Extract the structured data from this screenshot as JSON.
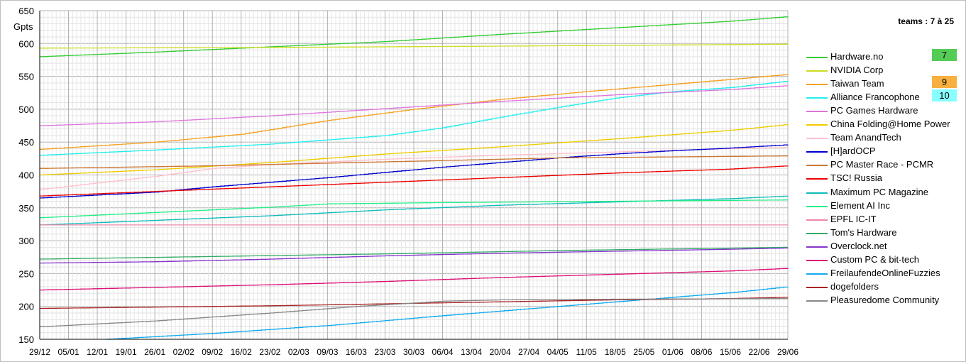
{
  "chart_data": {
    "type": "line",
    "subtitle": "teams : 7 à 25",
    "ylabel": "Gpts",
    "ylim": [
      150,
      650
    ],
    "yticks": [
      150,
      200,
      250,
      300,
      350,
      400,
      450,
      500,
      550,
      600,
      650
    ],
    "grid": true,
    "legend_position": "right",
    "x_labels": [
      "29/12",
      "05/01",
      "12/01",
      "19/01",
      "26/01",
      "02/02",
      "09/02",
      "16/02",
      "23/02",
      "02/03",
      "09/03",
      "16/03",
      "23/03",
      "30/03",
      "06/04",
      "13/04",
      "20/04",
      "27/04",
      "04/05",
      "11/05",
      "18/05",
      "25/05",
      "01/06",
      "08/06",
      "15/06",
      "22/06",
      "29/06"
    ],
    "series": [
      {
        "name": "Hardware.no",
        "color": "#33cc33",
        "anchors": [
          [
            0,
            580
          ],
          [
            4,
            587
          ],
          [
            8,
            595
          ],
          [
            12,
            603
          ],
          [
            16,
            614
          ],
          [
            20,
            624
          ],
          [
            24,
            634
          ],
          [
            26,
            641
          ]
        ]
      },
      {
        "name": "NVIDIA Corp",
        "color": "#ccdd22",
        "anchors": [
          [
            0,
            593
          ],
          [
            8,
            594
          ],
          [
            16,
            596
          ],
          [
            26,
            599
          ]
        ]
      },
      {
        "name": "Taiwan Team",
        "color": "#f5a020",
        "anchors": [
          [
            0,
            439
          ],
          [
            4,
            450
          ],
          [
            7,
            462
          ],
          [
            10,
            483
          ],
          [
            13,
            500
          ],
          [
            16,
            515
          ],
          [
            19,
            527
          ],
          [
            22,
            538
          ],
          [
            26,
            553
          ]
        ]
      },
      {
        "name": "Alliance Francophone",
        "color": "#22eeee",
        "anchors": [
          [
            0,
            430
          ],
          [
            4,
            438
          ],
          [
            8,
            447
          ],
          [
            12,
            460
          ],
          [
            14,
            472
          ],
          [
            16,
            488
          ],
          [
            18,
            503
          ],
          [
            20,
            517
          ],
          [
            22,
            527
          ],
          [
            24,
            533
          ],
          [
            26,
            543
          ]
        ]
      },
      {
        "name": "PC Games Hardware",
        "color": "#dd77dd",
        "anchors": [
          [
            0,
            475
          ],
          [
            4,
            481
          ],
          [
            8,
            490
          ],
          [
            12,
            501
          ],
          [
            16,
            512
          ],
          [
            20,
            522
          ],
          [
            24,
            530
          ],
          [
            26,
            536
          ]
        ]
      },
      {
        "name": "China Folding@Home Power",
        "color": "#eecc00",
        "anchors": [
          [
            0,
            400
          ],
          [
            4,
            408
          ],
          [
            8,
            419
          ],
          [
            12,
            432
          ],
          [
            16,
            443
          ],
          [
            20,
            455
          ],
          [
            24,
            468
          ],
          [
            26,
            477
          ]
        ]
      },
      {
        "name": "Team AnandTech",
        "color": "#ffc0cc",
        "anchors": [
          [
            0,
            378
          ],
          [
            4,
            398
          ],
          [
            6,
            410
          ],
          [
            8,
            416
          ],
          [
            12,
            424
          ],
          [
            16,
            430
          ],
          [
            20,
            435
          ],
          [
            24,
            440
          ],
          [
            26,
            442
          ]
        ]
      },
      {
        "name": "[H]ardOCP",
        "color": "#0000cc",
        "anchors": [
          [
            0,
            365
          ],
          [
            4,
            374
          ],
          [
            6,
            382
          ],
          [
            8,
            389
          ],
          [
            10,
            396
          ],
          [
            12,
            404
          ],
          [
            14,
            412
          ],
          [
            16,
            419
          ],
          [
            18,
            426
          ],
          [
            20,
            432
          ],
          [
            22,
            437
          ],
          [
            24,
            441
          ],
          [
            26,
            446
          ]
        ]
      },
      {
        "name": "PC Master Race - PCMR",
        "color": "#cc7733",
        "anchors": [
          [
            0,
            410
          ],
          [
            6,
            414
          ],
          [
            10,
            418
          ],
          [
            14,
            422
          ],
          [
            18,
            426
          ],
          [
            26,
            429
          ]
        ]
      },
      {
        "name": "TSC! Russia",
        "color": "#ee0000",
        "anchors": [
          [
            0,
            368
          ],
          [
            4,
            375
          ],
          [
            8,
            382
          ],
          [
            12,
            389
          ],
          [
            16,
            396
          ],
          [
            20,
            403
          ],
          [
            24,
            409
          ],
          [
            26,
            414
          ]
        ]
      },
      {
        "name": "Maximum PC Magazine",
        "color": "#11bbbb",
        "anchors": [
          [
            0,
            324
          ],
          [
            4,
            331
          ],
          [
            8,
            338
          ],
          [
            12,
            347
          ],
          [
            16,
            354
          ],
          [
            20,
            359
          ],
          [
            24,
            364
          ],
          [
            26,
            368
          ]
        ]
      },
      {
        "name": "Element AI Inc",
        "color": "#22ee88",
        "anchors": [
          [
            0,
            335
          ],
          [
            4,
            343
          ],
          [
            8,
            351
          ],
          [
            10,
            356
          ],
          [
            14,
            358
          ],
          [
            20,
            360
          ],
          [
            26,
            362
          ]
        ]
      },
      {
        "name": "EPFL IC-IT",
        "color": "#ee88aa",
        "anchors": [
          [
            0,
            324
          ],
          [
            26,
            324
          ]
        ]
      },
      {
        "name": "Tom's Hardware",
        "color": "#33aa66",
        "anchors": [
          [
            0,
            272
          ],
          [
            6,
            276
          ],
          [
            12,
            280
          ],
          [
            18,
            285
          ],
          [
            26,
            290
          ]
        ]
      },
      {
        "name": "Overclock.net",
        "color": "#8833cc",
        "anchors": [
          [
            0,
            266
          ],
          [
            4,
            268
          ],
          [
            8,
            272
          ],
          [
            12,
            277
          ],
          [
            16,
            281
          ],
          [
            20,
            284
          ],
          [
            24,
            287
          ],
          [
            26,
            289
          ]
        ]
      },
      {
        "name": "Custom PC & bit-tech",
        "color": "#dd1177",
        "anchors": [
          [
            0,
            225
          ],
          [
            4,
            229
          ],
          [
            8,
            233
          ],
          [
            12,
            238
          ],
          [
            16,
            244
          ],
          [
            20,
            249
          ],
          [
            24,
            254
          ],
          [
            26,
            258
          ]
        ]
      },
      {
        "name": "FreilaufendeOnlineFuzzies",
        "color": "#11aaee",
        "anchors": [
          [
            2.3,
            150
          ],
          [
            6,
            159
          ],
          [
            10,
            171
          ],
          [
            14,
            186
          ],
          [
            18,
            200
          ],
          [
            22,
            214
          ],
          [
            24,
            221
          ],
          [
            26,
            230
          ]
        ]
      },
      {
        "name": "dogefolders",
        "color": "#aa2222",
        "anchors": [
          [
            0,
            197
          ],
          [
            4,
            199
          ],
          [
            8,
            201
          ],
          [
            12,
            204
          ],
          [
            16,
            207
          ],
          [
            20,
            210
          ],
          [
            24,
            212
          ],
          [
            26,
            214
          ]
        ]
      },
      {
        "name": "Pleasuredome Community",
        "color": "#888888",
        "anchors": [
          [
            0,
            169
          ],
          [
            4,
            178
          ],
          [
            8,
            190
          ],
          [
            11,
            200
          ],
          [
            14,
            208
          ],
          [
            16,
            210
          ],
          [
            20,
            211
          ],
          [
            26,
            212
          ]
        ]
      }
    ],
    "ranks": [
      {
        "label": "7",
        "color": "#55cc55",
        "series": "Hardware.no"
      },
      {
        "label": "9",
        "color": "#f8b040",
        "series": "Taiwan Team"
      },
      {
        "label": "10",
        "color": "#88ffff",
        "series": "Alliance Francophone"
      }
    ]
  }
}
